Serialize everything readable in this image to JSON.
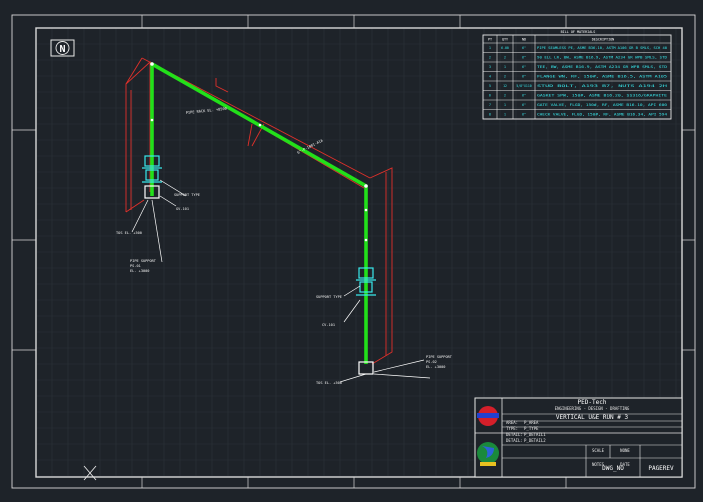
{
  "drawing": {
    "north_symbol": "N",
    "colors": {
      "background": "#1e2329",
      "grid": "#2b323a",
      "frame": "#d8d8d8",
      "pipe": "#22e01a",
      "dimension": "#e0302a",
      "bom_text": "#38e8ec",
      "label": "#f2f2f2"
    }
  },
  "bom": {
    "title": "BILL OF MATERIALS",
    "headers": [
      "PT",
      "QTY",
      "ND",
      "DESCRIPTION"
    ],
    "rows": [
      [
        "1",
        "6.00",
        "6\"",
        "PIPE SEAMLESS PE, ASME B36.10, ASTM A106 GR B SMLS, SCH 40"
      ],
      [
        "2",
        "2",
        "6\"",
        "90 ELL LR, BW, ASME B16.9, ASTM A234 GR WPB SMLS, STD"
      ],
      [
        "3",
        "1",
        "6\"",
        "TEE, BW, ASME B16.9, ASTM A234 GR WPB SMLS, STD"
      ],
      [
        "4",
        "2",
        "6\"",
        "FLANGE WN, RF, 150#, ASME B16.5, ASTM A105"
      ],
      [
        "5",
        "12",
        "5/8\"X110",
        "STUD BOLT, A193 B7, NUTS A194 2H"
      ],
      [
        "6",
        "2",
        "6\"",
        "GASKET SPW, 150#, ASME B16.20, SS316/GRAPHITE"
      ],
      [
        "7",
        "1",
        "6\"",
        "GATE VALVE, FLGD, 150#, RF, ASME B16.10, API 600"
      ],
      [
        "8",
        "1",
        "6\"",
        "CHECK VALVE, FLGD, 150#, RF, ASME B16.34, API 594"
      ]
    ]
  },
  "annotations": {
    "pipe_run_top": "PIPE RACK EL. +8500",
    "pipe_run_mid": "6\"-P-1001-A1A",
    "valve_left": "SUPPORT TYPE",
    "valve_left_tag": "GV-101",
    "support_left": "PIPE SUPPORT\nPS-01\nEL. +3000",
    "valve_right": "SUPPORT TYPE",
    "valve_right_tag": "CV-101",
    "support_right": "PIPE SUPPORT\nPS-02\nEL. +3000",
    "base_left": "TOS EL. +500",
    "base_right": "TOS EL. +500"
  },
  "title_block": {
    "company": "PED-Tech",
    "company_sub": "ENGINEERING - DESIGN - DRAFTING",
    "title": "VERTICAL U&E RUN # 3",
    "rows": [
      {
        "label": "AREA",
        "value": "P_AREA"
      },
      {
        "label": "TYPE",
        "value": "P_TYPE"
      },
      {
        "label": "DETAIL",
        "value": "P_DETAIL1"
      },
      {
        "label": "DETAIL",
        "value": "P_DETAIL2"
      }
    ],
    "cells": [
      "SCALE",
      "NONE",
      "NOTES",
      "DATE"
    ],
    "dwg_no": "DWG_NO",
    "page_rev": "PAGEREV"
  }
}
